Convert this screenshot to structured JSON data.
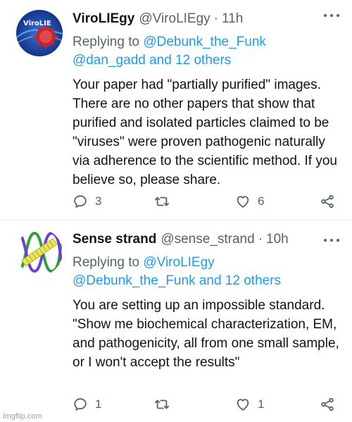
{
  "tweets": [
    {
      "name": "ViroLIEgy",
      "handle": "@ViroLIEgy",
      "sep": "·",
      "time": "11h",
      "reply_prefix": "Replying to ",
      "reply_line1_link": "@Debunk_the_Funk",
      "reply_line2_link": "@dan_gadd and 12 others",
      "text": "Your paper had \"partially purified\" images. There are no other papers that show that purified and isolated particles claimed to be \"viruses\" were proven pathogenic naturally via adherence to the scientific method. If you believe so, please share.",
      "replies": "3",
      "retweets": "",
      "likes": "6",
      "avatar_label": "ViroLIE"
    },
    {
      "name": "Sense strand",
      "handle": "@sense_strand",
      "sep": "·",
      "time": "10h",
      "reply_prefix": "Replying to ",
      "reply_line1_link": "@ViroLIEgy",
      "reply_line2_link": "@Debunk_the_Funk and 12 others",
      "text": "You are setting up an impossible standard. \"Show me biochemical characterization, EM, and pathogenicity, all from one small sample, or I won't accept the results\"",
      "replies": "1",
      "retweets": "",
      "likes": "1"
    }
  ],
  "watermark": "imgflip.com",
  "colors": {
    "link": "#1d9bf0",
    "muted": "#536471",
    "text": "#0f1419"
  },
  "icons": [
    "reply-icon",
    "retweet-icon",
    "like-icon",
    "share-icon",
    "more-icon"
  ]
}
